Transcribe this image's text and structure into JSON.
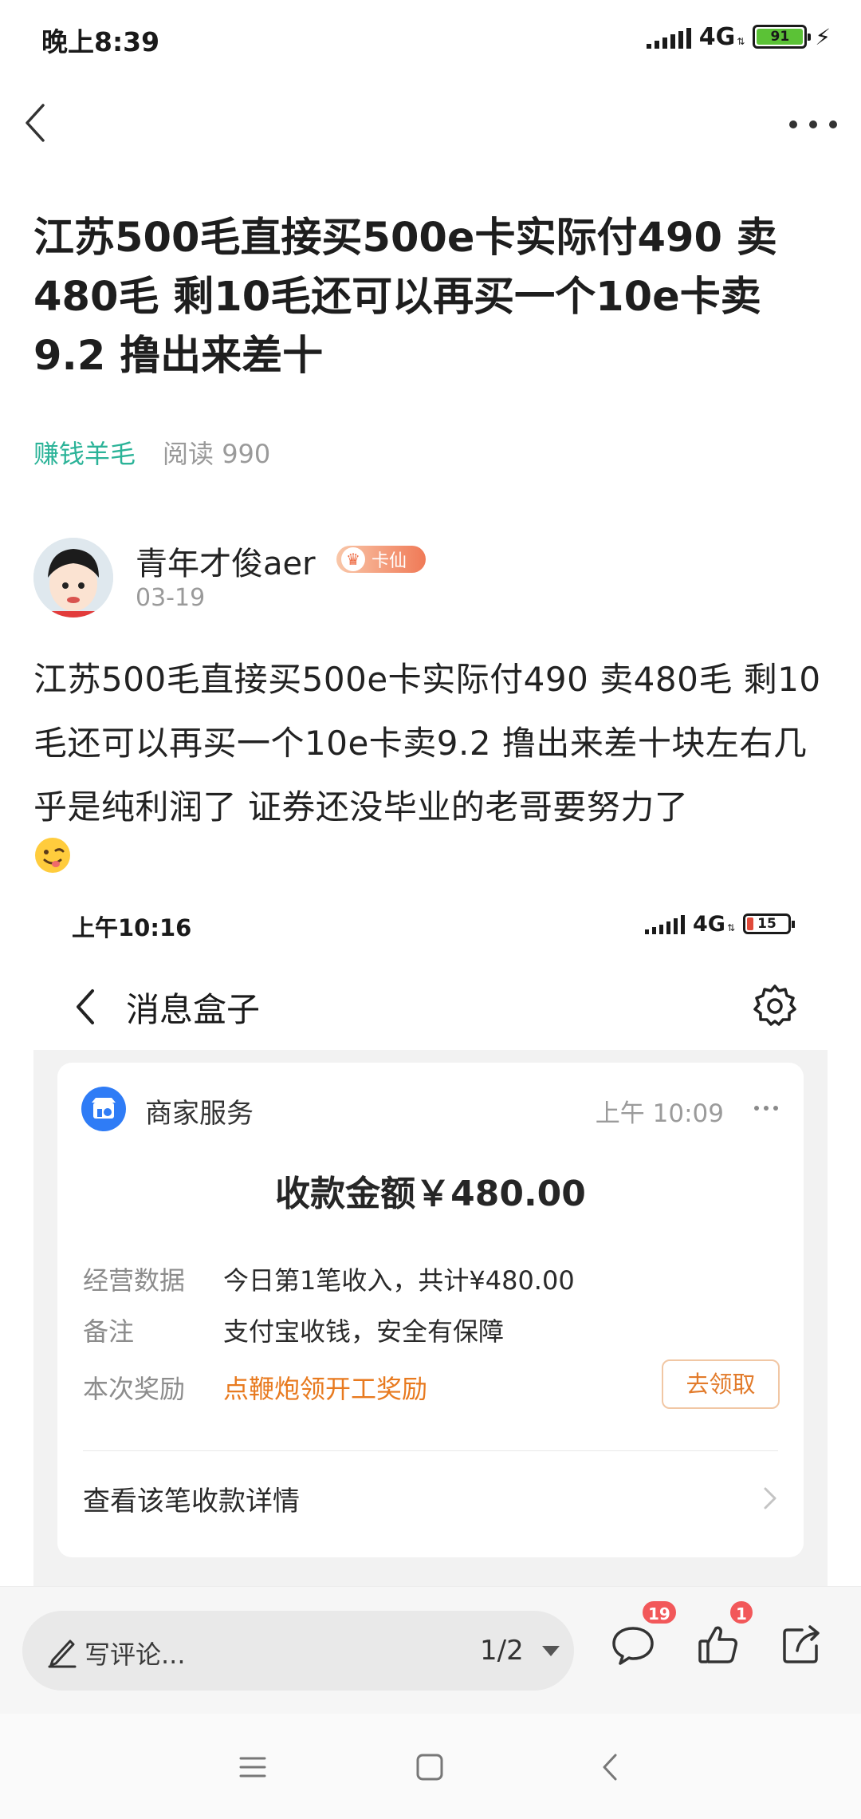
{
  "status_bar": {
    "time": "晚上8:39",
    "network": "4G",
    "battery_level": "91"
  },
  "navbar": {
    "back_icon": "chevron-left-icon",
    "more_icon": "more-horizontal-icon"
  },
  "post": {
    "title": "江苏500毛直接买500e卡实际付490 卖480毛 剩10毛还可以再买一个10e卡卖9.2 撸出来差十",
    "category": "赚钱羊毛",
    "reads": "阅读 990",
    "author": {
      "name": "青年才俊aer",
      "badge": "卡仙",
      "date": "03-19"
    },
    "body": "江苏500毛直接买500e卡实际付490 卖480毛 剩10毛还可以再买一个10e卡卖9.2 撸出来差十块左右几乎是纯利润了 证券还没毕业的老哥要努力了",
    "emoji_icon": "smirk-emoji-icon"
  },
  "screenshot": {
    "status_time": "上午10:16",
    "network": "4G",
    "battery_level": "15",
    "header_title": "消息盒子",
    "card": {
      "source": "商家服务",
      "time": "上午 10:09",
      "amount": "收款金额￥480.00",
      "rows": [
        {
          "label": "经营数据",
          "value": "今日第1笔收入，共计¥480.00"
        },
        {
          "label": "备注",
          "value": "支付宝收钱，安全有保障"
        },
        {
          "label": "本次奖励",
          "value": "点鞭炮领开工奖励"
        }
      ],
      "claim_button": "去领取",
      "detail_link": "查看该笔收款详情"
    }
  },
  "action_bar": {
    "comment_placeholder": "写评论...",
    "pager": "1/2",
    "comment_count": "19",
    "like_count": "1"
  },
  "colors": {
    "accent_green": "#2bb398",
    "badge_red": "#f2585a",
    "reward_orange": "#e87a1f",
    "merchant_blue": "#2f7cf6"
  }
}
